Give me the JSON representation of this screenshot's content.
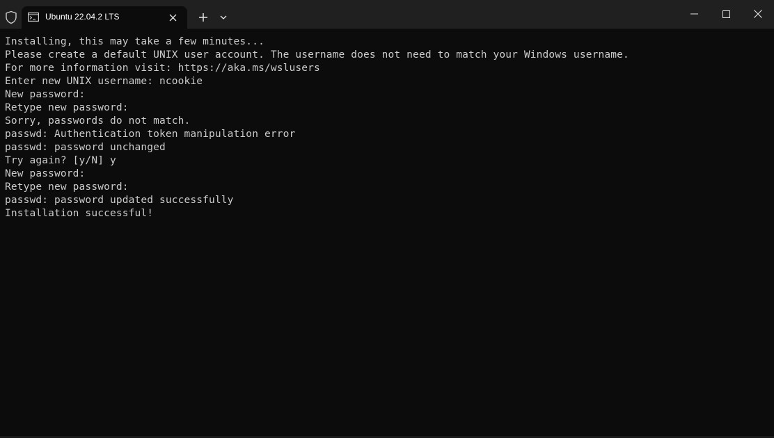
{
  "tab": {
    "title": "Ubuntu 22.04.2 LTS",
    "icon": "terminal-icon"
  },
  "titlebar": {
    "icons": [
      "shield-icon",
      "close-icon",
      "plus-icon",
      "chevron-down-icon",
      "minimize-icon",
      "maximize-icon",
      "window-close-icon"
    ]
  },
  "colors": {
    "background": "#0c0c0c",
    "titlebar": "#202020",
    "text": "#cccccc"
  },
  "terminal": {
    "lines": [
      "Installing, this may take a few minutes...",
      "Please create a default UNIX user account. The username does not need to match your Windows username.",
      "For more information visit: https://aka.ms/wslusers",
      "Enter new UNIX username: ncookie",
      "New password:",
      "Retype new password:",
      "Sorry, passwords do not match.",
      "passwd: Authentication token manipulation error",
      "passwd: password unchanged",
      "Try again? [y/N] y",
      "New password:",
      "Retype new password:",
      "passwd: password updated successfully",
      "Installation successful!"
    ]
  }
}
